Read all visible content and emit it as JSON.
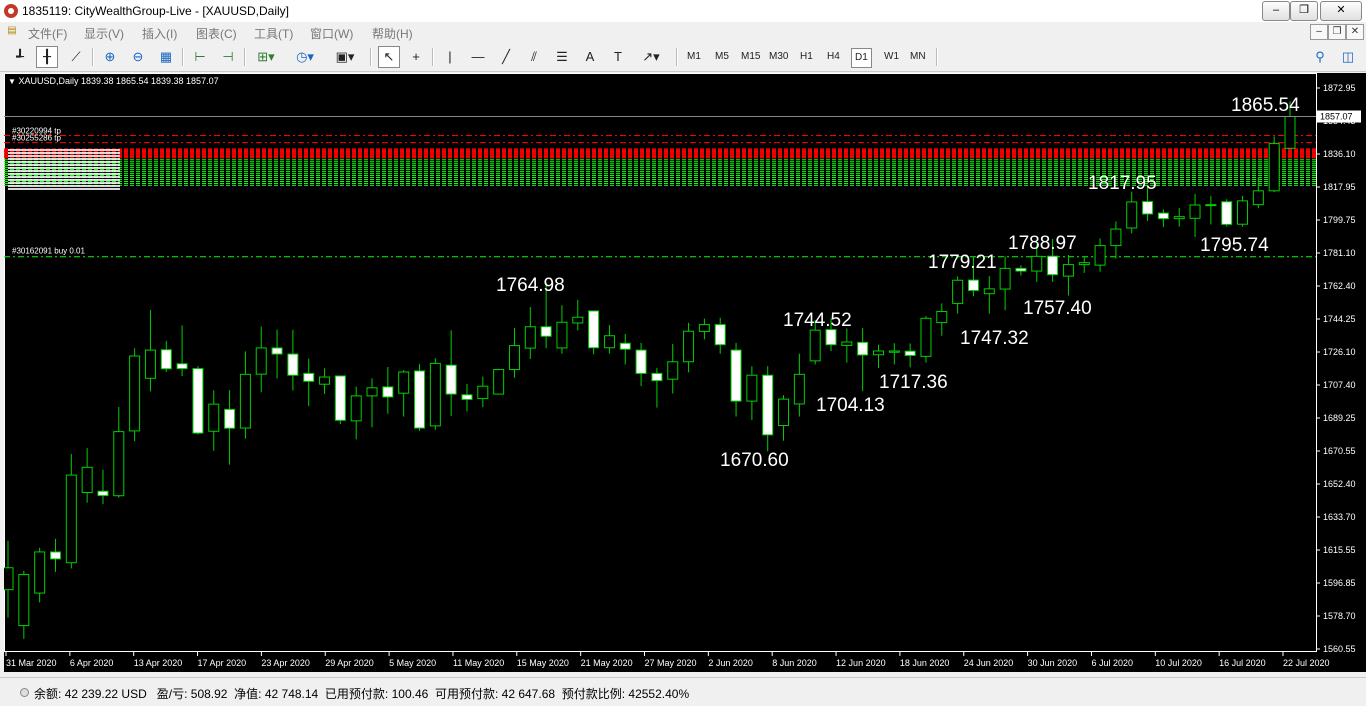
{
  "window": {
    "title": "1835119: CityWealthGroup-Live - [XAUUSD,Daily]",
    "min": "–",
    "max": "❐",
    "close": "✕"
  },
  "menu": [
    "文件(F)",
    "显示(V)",
    "插入(I)",
    "图表(C)",
    "工具(T)",
    "窗口(W)",
    "帮助(H)"
  ],
  "toolbar": {
    "timeframes": [
      "M1",
      "M5",
      "M15",
      "M30",
      "H1",
      "H4",
      "D1",
      "W1",
      "MN"
    ],
    "active_timeframe": "D1"
  },
  "chart": {
    "header": "XAUUSD,Daily  1839.38 1865.54 1839.38 1857.07",
    "current_price_label": "1857.07",
    "price_ticks": [
      "1872.95",
      "1854.45",
      "1836.10",
      "1817.95",
      "1799.75",
      "1781.10",
      "1762.40",
      "1744.25",
      "1726.10",
      "1707.40",
      "1689.25",
      "1670.55",
      "1652.40",
      "1633.70",
      "1615.55",
      "1596.85",
      "1578.70",
      "1560.55"
    ],
    "date_ticks": [
      "31 Mar 2020",
      "6 Apr 2020",
      "13 Apr 2020",
      "17 Apr 2020",
      "23 Apr 2020",
      "29 Apr 2020",
      "5 May 2020",
      "11 May 2020",
      "15 May 2020",
      "21 May 2020",
      "27 May 2020",
      "2 Jun 2020",
      "8 Jun 2020",
      "12 Jun 2020",
      "18 Jun 2020",
      "24 Jun 2020",
      "30 Jun 2020",
      "6 Jul 2020",
      "10 Jul 2020",
      "16 Jul 2020",
      "22 Jul 2020"
    ],
    "order_labels": [
      "#30220994 tp",
      "#30255286 tp",
      "#30162091 buy 0.01"
    ],
    "annotations": [
      "1865.54",
      "1817.95",
      "1795.74",
      "1788.97",
      "1779.21",
      "1757.40",
      "1747.32",
      "1764.98",
      "1744.52",
      "1717.36",
      "1704.13",
      "1670.60"
    ],
    "colors": {
      "bull": "#00d000",
      "bear": "#ffffff",
      "grid_green": "#00ff00",
      "tp_red": "#ff0000",
      "axis": "#ffffff"
    }
  },
  "chart_data": {
    "type": "candlestick",
    "symbol": "XAUUSD",
    "timeframe": "Daily",
    "last_bar": {
      "open": 1839.38,
      "high": 1865.54,
      "low": 1839.38,
      "close": 1857.07
    },
    "ylim": [
      1560.55,
      1872.95
    ],
    "order_levels": [
      {
        "label": "#30220994 tp",
        "price": 1846.5
      },
      {
        "label": "#30255286 tp",
        "price": 1842.5
      },
      {
        "label": "#30162091 buy 0.01",
        "price": 1779.0
      }
    ],
    "candles": [
      [
        1593.6,
        1605.8,
        1578.0,
        1620.8
      ],
      [
        1573.6,
        1602.0,
        1566.2,
        1604.1
      ],
      [
        1591.7,
        1614.6,
        1586.5,
        1616.9
      ],
      [
        1614.6,
        1610.7,
        1603.5,
        1621.9
      ],
      [
        1608.6,
        1657.4,
        1605.4,
        1669.1
      ],
      [
        1647.7,
        1661.7,
        1642.0,
        1672.4
      ],
      [
        1648.4,
        1646.0,
        1641.2,
        1660.4
      ],
      [
        1645.9,
        1681.6,
        1644.8,
        1695.3
      ],
      [
        1682.0,
        1723.7,
        1676.3,
        1728.0
      ],
      [
        1711.3,
        1727.0,
        1704.0,
        1749.3
      ],
      [
        1727.2,
        1716.6,
        1714.8,
        1732.2
      ],
      [
        1719.4,
        1716.7,
        1712.5,
        1740.7
      ],
      [
        1716.7,
        1680.8,
        1680.0,
        1718.1
      ],
      [
        1681.8,
        1696.9,
        1670.9,
        1704.6
      ],
      [
        1694.0,
        1683.5,
        1663.2,
        1704.7
      ],
      [
        1683.6,
        1713.5,
        1677.7,
        1726.3
      ],
      [
        1713.6,
        1728.2,
        1703.5,
        1740.1
      ],
      [
        1728.2,
        1724.8,
        1711.2,
        1738.5
      ],
      [
        1724.8,
        1713.0,
        1704.5,
        1738.3
      ],
      [
        1714.0,
        1709.6,
        1695.8,
        1722.2
      ],
      [
        1708.0,
        1712.0,
        1702.6,
        1716.8
      ],
      [
        1712.6,
        1687.9,
        1685.9,
        1712.8
      ],
      [
        1687.6,
        1701.5,
        1677.3,
        1706.7
      ],
      [
        1701.5,
        1706.0,
        1684.0,
        1711.3
      ],
      [
        1706.5,
        1700.9,
        1691.5,
        1717.6
      ],
      [
        1703.0,
        1714.8,
        1690.0,
        1715.9
      ],
      [
        1715.4,
        1683.6,
        1682.0,
        1719.1
      ],
      [
        1684.8,
        1719.6,
        1682.6,
        1722.4
      ],
      [
        1718.6,
        1702.5,
        1690.2,
        1738.0
      ],
      [
        1702.1,
        1699.5,
        1692.8,
        1708.2
      ],
      [
        1700.0,
        1706.9,
        1695.2,
        1712.2
      ],
      [
        1702.5,
        1716.2,
        1704.3,
        1716.6
      ],
      [
        1716.2,
        1729.5,
        1711.6,
        1739.3
      ],
      [
        1728.1,
        1740.0,
        1722.0,
        1751.0
      ],
      [
        1740.0,
        1734.7,
        1728.0,
        1764.98
      ],
      [
        1728.2,
        1742.5,
        1725.0,
        1752.0
      ],
      [
        1742.1,
        1745.3,
        1738.0,
        1755.0
      ],
      [
        1748.8,
        1728.3,
        1724.7,
        1748.8
      ],
      [
        1728.3,
        1735.0,
        1725.0,
        1741.0
      ],
      [
        1730.8,
        1727.5,
        1719.0,
        1736.0
      ],
      [
        1727.0,
        1714.0,
        1707.0,
        1731.0
      ],
      [
        1714.0,
        1710.0,
        1695.0,
        1717.0
      ],
      [
        1710.8,
        1720.5,
        1702.8,
        1730.4
      ],
      [
        1720.5,
        1737.5,
        1714.6,
        1742.2
      ],
      [
        1737.4,
        1741.2,
        1733.0,
        1744.5
      ],
      [
        1741.2,
        1730.0,
        1725.0,
        1745.0
      ],
      [
        1727.0,
        1698.6,
        1690.0,
        1731.0
      ],
      [
        1698.6,
        1713.0,
        1688.0,
        1718.0
      ],
      [
        1713.0,
        1679.8,
        1670.6,
        1718.0
      ],
      [
        1685.0,
        1699.7,
        1676.5,
        1701.9
      ],
      [
        1697.0,
        1713.5,
        1690.0,
        1725.0
      ],
      [
        1721.0,
        1738.1,
        1719.0,
        1743.8
      ],
      [
        1738.4,
        1730.0,
        1726.4,
        1744.52
      ],
      [
        1729.6,
        1731.5,
        1720.0,
        1739.0
      ],
      [
        1731.3,
        1724.3,
        1704.13,
        1739.3
      ],
      [
        1724.4,
        1726.5,
        1717.0,
        1730.0
      ],
      [
        1725.8,
        1726.5,
        1719.0,
        1730.8
      ],
      [
        1726.4,
        1724.0,
        1717.36,
        1730.7
      ],
      [
        1723.5,
        1744.7,
        1720.0,
        1746.0
      ],
      [
        1742.3,
        1748.5,
        1735.0,
        1753.0
      ],
      [
        1753.0,
        1765.9,
        1747.32,
        1768.0
      ],
      [
        1766.0,
        1760.2,
        1757.0,
        1779.21
      ],
      [
        1758.4,
        1761.1,
        1747.32,
        1768.2
      ],
      [
        1761.0,
        1772.5,
        1749.2,
        1779.2
      ],
      [
        1772.5,
        1771.0,
        1768.5,
        1774.3
      ],
      [
        1771.0,
        1779.2,
        1765.0,
        1785.9
      ],
      [
        1779.3,
        1769.0,
        1765.0,
        1788.97
      ],
      [
        1768.2,
        1774.6,
        1757.4,
        1780.0
      ],
      [
        1774.6,
        1775.7,
        1770.0,
        1779.0
      ],
      [
        1774.3,
        1785.2,
        1770.6,
        1789.2
      ],
      [
        1785.2,
        1794.4,
        1777.9,
        1798.6
      ],
      [
        1795.0,
        1809.5,
        1792.0,
        1815.2
      ],
      [
        1809.7,
        1802.8,
        1798.9,
        1817.95
      ],
      [
        1803.3,
        1800.2,
        1795.5,
        1805.3
      ],
      [
        1800.2,
        1801.3,
        1795.74,
        1806.2
      ],
      [
        1800.4,
        1807.8,
        1790.0,
        1814.0
      ],
      [
        1808.0,
        1808.0,
        1797.0,
        1812.9
      ],
      [
        1809.6,
        1797.0,
        1795.74,
        1811.0
      ],
      [
        1797.1,
        1810.1,
        1795.74,
        1812.9
      ],
      [
        1808.0,
        1815.7,
        1806.0,
        1823.4
      ],
      [
        1815.7,
        1842.0,
        1815.0,
        1846.0
      ],
      [
        1839.38,
        1857.07,
        1839.38,
        1865.54
      ]
    ]
  },
  "status": {
    "balance_label": "余额:",
    "balance": "42 239.22 USD",
    "pl_label": "盈/亏:",
    "pl": "508.92",
    "equity_label": "净值:",
    "equity": "42 748.14",
    "margin_label": "已用预付款:",
    "margin": "100.46",
    "free_margin_label": "可用预付款:",
    "free_margin": "42 647.68",
    "margin_level_label": "预付款比例:",
    "margin_level": "42552.40%"
  }
}
